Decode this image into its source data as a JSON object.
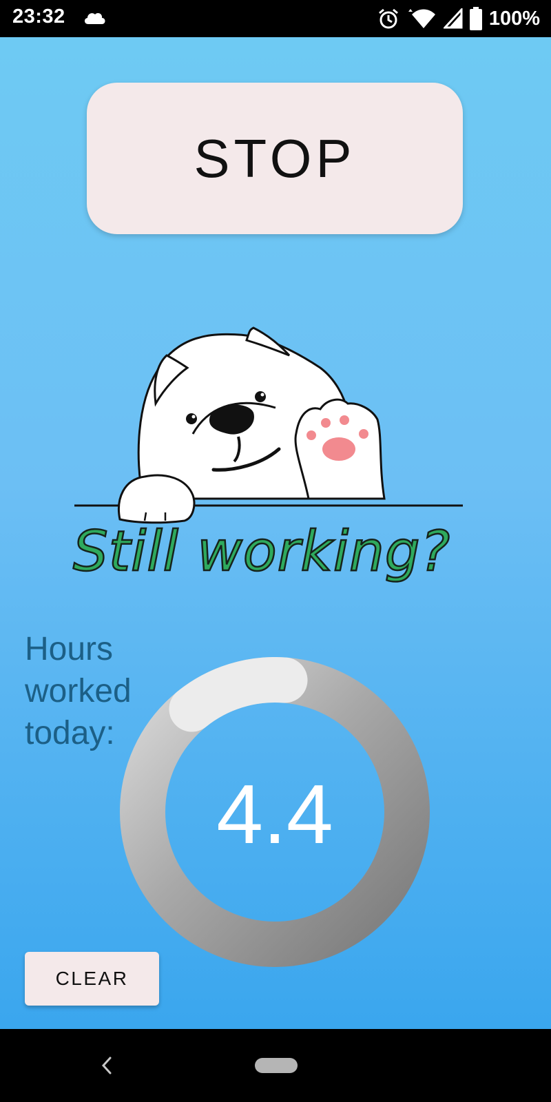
{
  "status_bar": {
    "time": "23:32",
    "battery_percent": "100%",
    "icons": [
      "cloud-icon",
      "alarm-icon",
      "wifi-icon",
      "signal-icon",
      "battery-icon"
    ]
  },
  "main": {
    "stop_button_label": "STOP",
    "prompt_text": "Still working?",
    "hours_label": "Hours worked today:",
    "hours_value": "4.4",
    "progress_fraction": 0.12,
    "clear_button_label": "CLEAR"
  },
  "nav_bar": {
    "icons": [
      "back-icon",
      "home-pill-icon"
    ]
  },
  "colors": {
    "background_top": "#6ecaf3",
    "background_bottom": "#3aa6ee",
    "button_bg": "#f4e9ea",
    "prompt_text": "#2eaa5e",
    "hours_label": "#1c5f86",
    "ring_track": "#838383",
    "ring_progress": "#e8e8e8"
  }
}
